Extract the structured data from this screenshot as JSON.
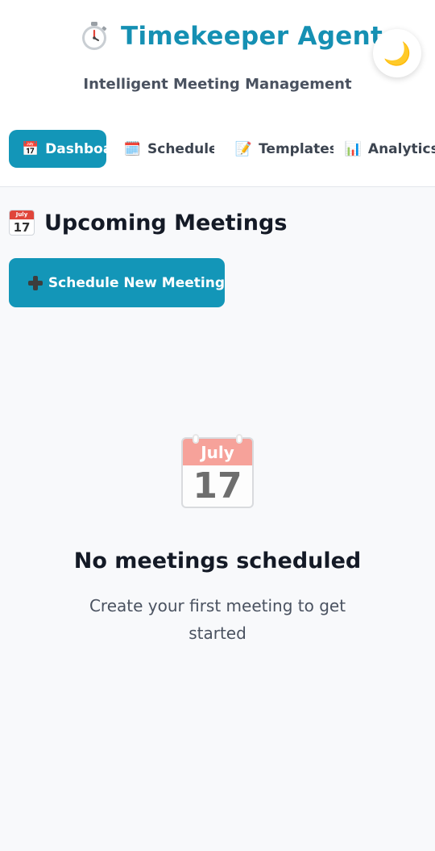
{
  "app": {
    "title": "Timekeeper Agent",
    "subtitle": "Intelligent Meeting Management",
    "theme_toggle_icon": "🌙"
  },
  "nav": {
    "tabs": [
      {
        "label": "Dashboard",
        "icon": "📅",
        "icon_name": "calendar-icon",
        "active": true
      },
      {
        "label": "Schedule",
        "icon": "🗓️",
        "icon_name": "spiral-calendar-icon",
        "active": false
      },
      {
        "label": "Templates",
        "icon": "📝",
        "icon_name": "memo-icon",
        "active": false
      },
      {
        "label": "Analytics",
        "icon": "📊",
        "icon_name": "bar-chart-icon",
        "active": false
      }
    ]
  },
  "main": {
    "section_title": "Upcoming Meetings",
    "section_icon_month": "July",
    "section_icon_day": "17",
    "new_meeting_label": "Schedule New Meeting",
    "empty_state": {
      "calendar_month": "July",
      "calendar_day": "17",
      "title": "No meetings scheduled",
      "message": "Create your first meeting to get started"
    }
  },
  "colors": {
    "accent": "#1396b8",
    "title": "#1590b3",
    "background": "#f8f9fb",
    "calendar_band": "#f6a29a"
  }
}
